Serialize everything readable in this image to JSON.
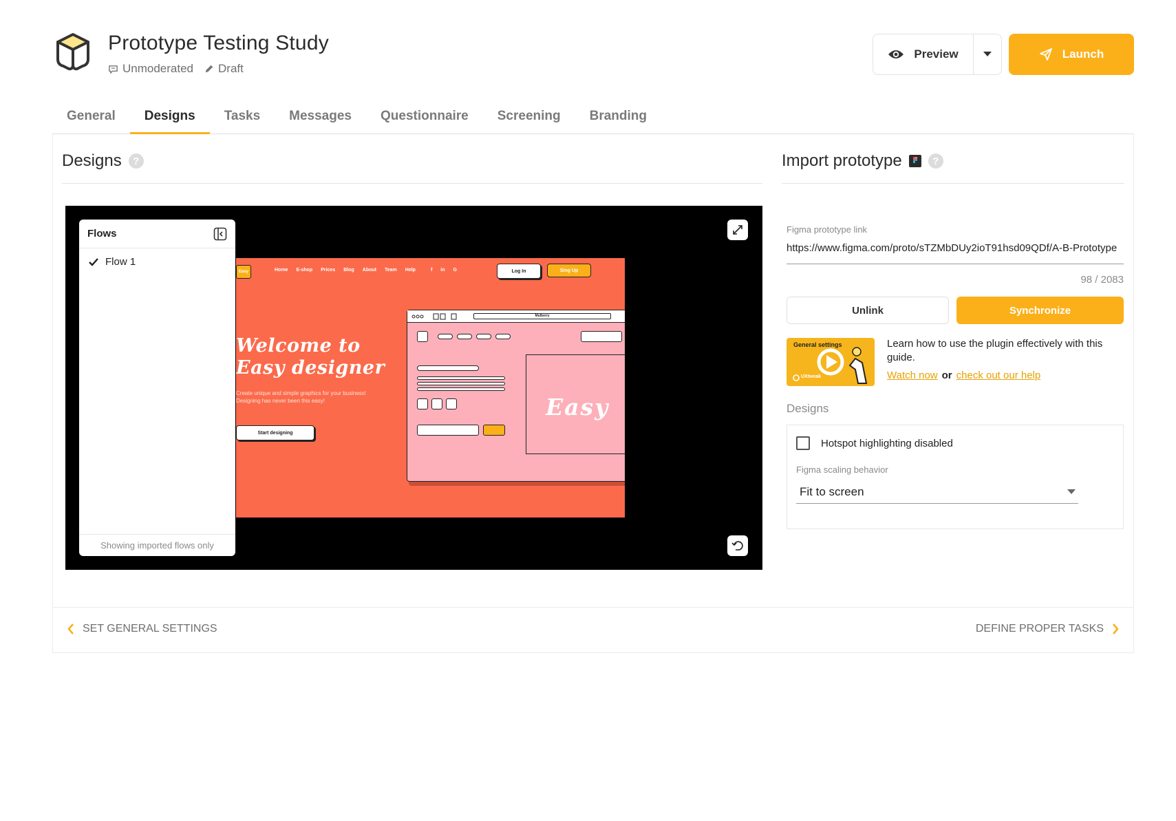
{
  "header": {
    "title": "Prototype Testing Study",
    "mode": "Unmoderated",
    "status": "Draft",
    "preview_label": "Preview",
    "launch_label": "Launch"
  },
  "tabs": [
    {
      "label": "General",
      "active": false
    },
    {
      "label": "Designs",
      "active": true
    },
    {
      "label": "Tasks",
      "active": false
    },
    {
      "label": "Messages",
      "active": false
    },
    {
      "label": "Questionnaire",
      "active": false
    },
    {
      "label": "Screening",
      "active": false
    },
    {
      "label": "Branding",
      "active": false
    }
  ],
  "designs": {
    "heading": "Designs",
    "help": "?",
    "flows": {
      "title": "Flows",
      "items": [
        {
          "label": "Flow 1",
          "checked": true
        }
      ],
      "footer": "Showing imported flows only"
    },
    "prototype": {
      "logo": "Easy",
      "nav": [
        "Home",
        "E-shop",
        "Prices",
        "Blog",
        "About",
        "Team",
        "Help",
        "f",
        "in",
        "G"
      ],
      "login": "Log In",
      "signup": "Sing Up",
      "hero_title": "Welcome to Easy designer",
      "hero_sub": "Create unique and simple graphics for your business! Designing has never been this easy!",
      "start": "Start designing",
      "window_url": "Mulberry",
      "big_word": "Easy"
    }
  },
  "import": {
    "heading": "Import prototype",
    "help": "?",
    "link_label": "Figma prototype link",
    "link_value": "https://www.figma.com/proto/sTZMbDUy2ioT91hsd09QDf/A-B-Prototype",
    "counter": "98 / 2083",
    "unlink_label": "Unlink",
    "sync_label": "Synchronize",
    "guide_thumb_label": "General settings",
    "guide_brand": "UXtweak",
    "guide_text": "Learn how to use the plugin effectively with this guide.",
    "watch_now": "Watch now",
    "or": "or",
    "help_link": "check out our help",
    "section_label": "Designs",
    "hotspot_label": "Hotspot highlighting disabled",
    "hotspot_checked": false,
    "scaling_label": "Figma scaling behavior",
    "scaling_value": "Fit to screen"
  },
  "footer": {
    "prev": "SET GENERAL SETTINGS",
    "next": "DEFINE PROPER TASKS"
  },
  "colors": {
    "accent": "#fbb01a",
    "proto_bg": "#fb6a4b",
    "proto_window": "#fdb0ba"
  }
}
